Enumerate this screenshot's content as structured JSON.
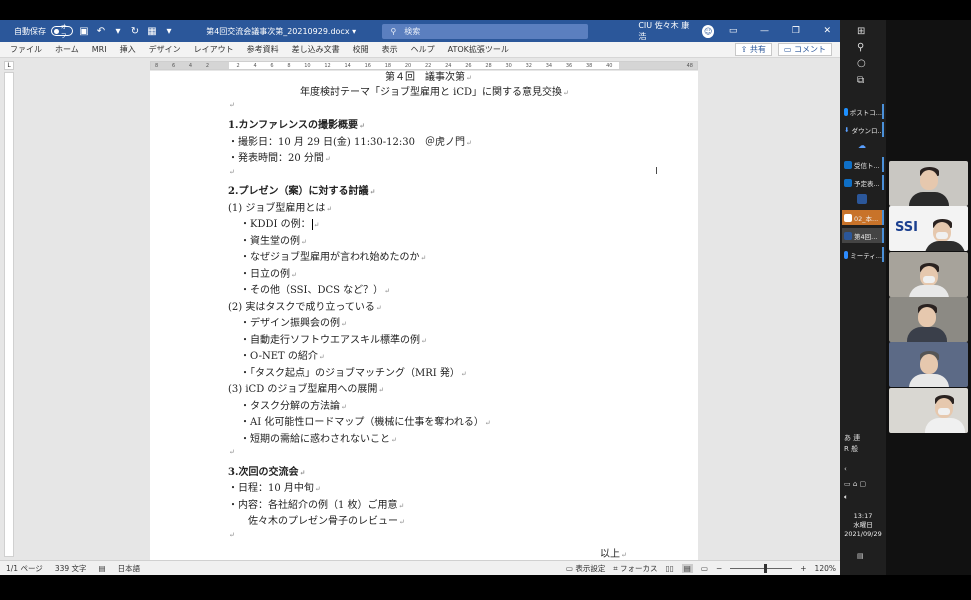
{
  "titlebar": {
    "autosave_label": "自動保存",
    "autosave_state": "オフ",
    "doc_title": "第4回交流会議事次第_20210929.docx",
    "search_placeholder": "検索",
    "user_name": "CIU 佐々木 康浩"
  },
  "menu": {
    "items": [
      "ファイル",
      "ホーム",
      "MRI",
      "挿入",
      "デザイン",
      "レイアウト",
      "参考資料",
      "差し込み文書",
      "校閲",
      "表示",
      "ヘルプ",
      "ATOK拡張ツール"
    ],
    "share_label": "共有",
    "comment_label": "コメント"
  },
  "ruler": {
    "ticks": [
      "8",
      "6",
      "4",
      "2",
      "",
      "2",
      "4",
      "6",
      "8",
      "10",
      "12",
      "14",
      "16",
      "18",
      "20",
      "22",
      "24",
      "26",
      "28",
      "30",
      "32",
      "34",
      "36",
      "38",
      "40",
      "42",
      "44",
      "46",
      "48"
    ]
  },
  "document": {
    "top_partial": "第４回　議事次第",
    "subtitle": "年度検討テーマ「ジョブ型雇用と iCD」に関する意見交換",
    "lines": [
      "1.カンファレンスの撮影概要",
      "・撮影日：10 月 29 日(金) 11:30-12:30　＠虎ノ門",
      "・発表時間：20 分間",
      "2.プレゼン（案）に対する討議",
      "(1)  ジョブ型雇用とは",
      "・KDDI の例：",
      "・資生堂の例",
      "・なぜジョブ型雇用が言われ始めたのか",
      "・日立の例",
      "・その他（SSI、DCS など？）",
      "(2)  実はタスクで成り立っている",
      "・デザイン振興会の例",
      "・自動走行ソフトウエアスキル標準の例",
      "・O-NET の紹介",
      "・「タスク起点」のジョブマッチング（MRI 発）",
      "(3)  iCD のジョブ型雇用への展開",
      "・タスク分解の方法論",
      "・AI 化可能性ロードマップ（機械に仕事を奪われる）",
      "・短期の需給に惑わされないこと",
      "3.次回の交流会",
      "・日程：10 月中旬",
      "・内容：各社紹介の例（1 枚）ご用意",
      "佐々木のプレゼン骨子のレビュー",
      "以上"
    ]
  },
  "status": {
    "page": "1/1 ページ",
    "words": "339 文字",
    "lang": "日本語",
    "display_settings": "表示設定",
    "focus": "フォーカス",
    "zoom": "120%",
    "zoom_minus": "−",
    "zoom_plus": "+"
  },
  "taskbar": {
    "apps": [
      "ポストコ...",
      "ダウンロ...",
      "受信ト...",
      "予定表...",
      "02_本...",
      "第4回...",
      "ミーティ..."
    ],
    "tray_1": "あ 連",
    "tray_2": "R 般",
    "clock_time": "13:17",
    "clock_day": "水曜日",
    "clock_date": "2021/09/29"
  },
  "video": {
    "logo_text": "SSI"
  },
  "colors": {
    "word_blue": "#2b579a",
    "active_app": "#c8732a",
    "taskbar": "#1f1f1f"
  }
}
